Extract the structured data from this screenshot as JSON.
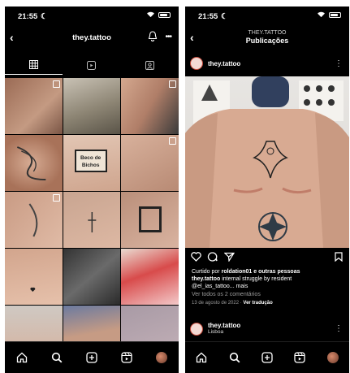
{
  "status": {
    "time": "21:55"
  },
  "left": {
    "title": "they.tattoo",
    "tabs": [
      "grid-icon",
      "reels-icon",
      "tagged-icon"
    ]
  },
  "right": {
    "account": "THEY.TATTOO",
    "header": "Publicações",
    "post": {
      "username": "they.tattoo",
      "liked_prefix": "Curtido por",
      "liked_user": "roldation01",
      "liked_suffix": "e outras pessoas",
      "caption_user": "they.tattoo",
      "caption_text": "internal struggle by resident",
      "caption_line2": "@el_ias_tattoo... mais",
      "comments": "Ver todos os 2 comentários",
      "date": "13 de agosto de 2022",
      "translate": "Ver tradução"
    },
    "next_post": {
      "username": "they.tattoo",
      "location": "Lisboa"
    }
  },
  "grid_text": {
    "banner_line1": "Beco de",
    "banner_line2": "Bichos"
  },
  "colors": {
    "accent": "#ffffff",
    "background": "#000000"
  }
}
